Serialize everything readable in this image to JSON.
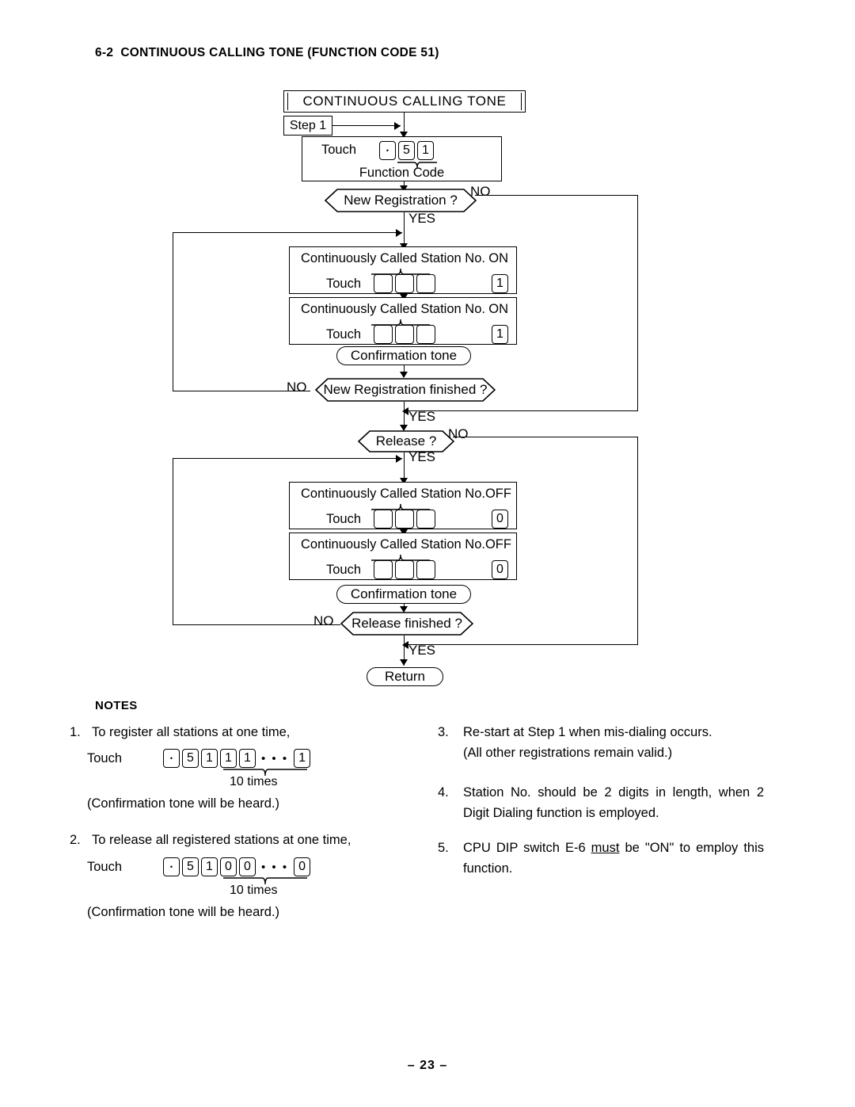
{
  "heading": {
    "number": "6-2",
    "title": "CONTINUOUS CALLING TONE (FUNCTION CODE 51)"
  },
  "flowchart": {
    "title_terminal": "CONTINUOUS  CALLING  TONE",
    "step_label": "Step 1",
    "function_code_box": {
      "touch_label": "Touch",
      "keys": [
        "•",
        "5",
        "1"
      ],
      "brace_label": "Function  Code"
    },
    "decisions": {
      "new_registration": "New Registration ?",
      "new_registration_finished": "New Registration finished ?",
      "release": "Release ?",
      "release_finished": "Release finished ?"
    },
    "branch_labels": {
      "yes": "YES",
      "no": "NO"
    },
    "on_boxes": [
      {
        "caption_left": "Continuously Called Station No.",
        "caption_right": "ON",
        "touch_label": "Touch",
        "station_keys": [
          "",
          "",
          ""
        ],
        "state_key": "1"
      },
      {
        "caption_left": "Continuously Called Station No.",
        "caption_right": "ON",
        "touch_label": "Touch",
        "station_keys": [
          "",
          "",
          ""
        ],
        "state_key": "1"
      }
    ],
    "off_boxes": [
      {
        "caption_left": "Continuously Called Station No.",
        "caption_right": "OFF",
        "touch_label": "Touch",
        "station_keys": [
          "",
          "",
          ""
        ],
        "state_key": "0"
      },
      {
        "caption_left": "Continuously Called Station No.",
        "caption_right": "OFF",
        "touch_label": "Touch",
        "station_keys": [
          "",
          "",
          ""
        ],
        "state_key": "0"
      }
    ],
    "confirmation_tone": "Confirmation tone",
    "return_terminal": "Return"
  },
  "notes": {
    "title": "NOTES",
    "items": [
      {
        "index": "1.",
        "text": "To register all stations at one time,",
        "touch_label": "Touch",
        "keys_prefix": [
          "•",
          "5",
          "1"
        ],
        "keys_repeat": [
          "1",
          "1"
        ],
        "ellipsis": "• • •",
        "keys_last": "1",
        "repeat_label": "10 times",
        "footnote": "(Confirmation tone will be heard.)"
      },
      {
        "index": "2.",
        "text": "To release all registered stations at one time,",
        "touch_label": "Touch",
        "keys_prefix": [
          "•",
          "5",
          "1"
        ],
        "keys_repeat": [
          "0",
          "0"
        ],
        "ellipsis": "• • •",
        "keys_last": "0",
        "repeat_label": "10 times",
        "footnote": "(Confirmation tone will be heard.)"
      },
      {
        "index": "3.",
        "line1": "Re-start at Step 1 when mis-dialing occurs.",
        "line2": "(All other registrations remain valid.)"
      },
      {
        "index": "4.",
        "text": "Station No. should be 2 digits in length, when 2 Digit Dialing function is employed."
      },
      {
        "index": "5.",
        "text_before": "CPU  DIP  switch  E-6  ",
        "emphasis": "must",
        "text_after": "  be \"ON\" to employ this function."
      }
    ]
  },
  "page_number": "– 23 –"
}
